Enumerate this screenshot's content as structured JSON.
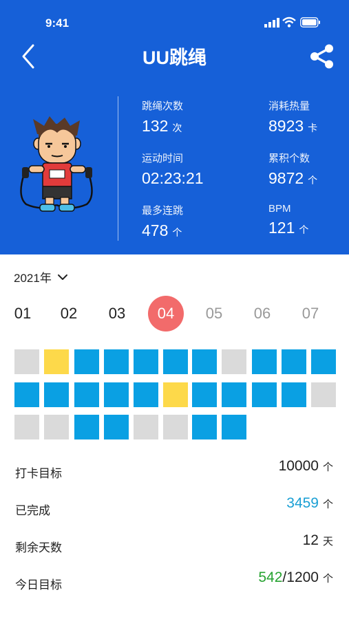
{
  "status_bar": {
    "time": "9:41"
  },
  "header": {
    "title": "UU跳绳"
  },
  "stats": [
    {
      "label": "跳绳次数",
      "value": "132",
      "unit": "次"
    },
    {
      "label": "消耗热量",
      "value": "8923",
      "unit": "卡"
    },
    {
      "label": "运动时间",
      "value": "02:23:21",
      "unit": ""
    },
    {
      "label": "累积个数",
      "value": "9872",
      "unit": "个"
    },
    {
      "label": "最多连跳",
      "value": "478",
      "unit": "个"
    },
    {
      "label": "BPM",
      "value": "121",
      "unit": "个"
    }
  ],
  "year_selector": {
    "value": "2021年"
  },
  "months": [
    "01",
    "02",
    "03",
    "04",
    "05",
    "06",
    "07"
  ],
  "active_month": "04",
  "calendar": [
    [
      "gray",
      "yellow",
      "blue",
      "blue",
      "blue",
      "blue",
      "blue",
      "gray",
      "blue",
      "blue",
      "blue"
    ],
    [
      "blue",
      "blue",
      "blue",
      "blue",
      "blue",
      "yellow",
      "blue",
      "blue",
      "blue",
      "blue",
      "gray"
    ],
    [
      "gray",
      "gray",
      "blue",
      "blue",
      "gray",
      "gray",
      "blue",
      "blue"
    ]
  ],
  "colors": {
    "header_bg": "#1660d8",
    "active_month": "#f26b6b",
    "done": "#0aa0e3",
    "partial": "#fdd94a",
    "missed": "#dadada",
    "completed_text": "#1a9fd4",
    "today_progress": "#27a331"
  },
  "summary": {
    "goal": {
      "label": "打卡目标",
      "value": "10000",
      "unit": "个"
    },
    "completed": {
      "label": "已完成",
      "value": "3459",
      "unit": "个"
    },
    "remaining_days": {
      "label": "剩余天数",
      "value": "12",
      "unit": "天"
    },
    "today": {
      "label": "今日目标",
      "done": "542",
      "slash": "/",
      "target": "1200",
      "unit": "个"
    }
  }
}
